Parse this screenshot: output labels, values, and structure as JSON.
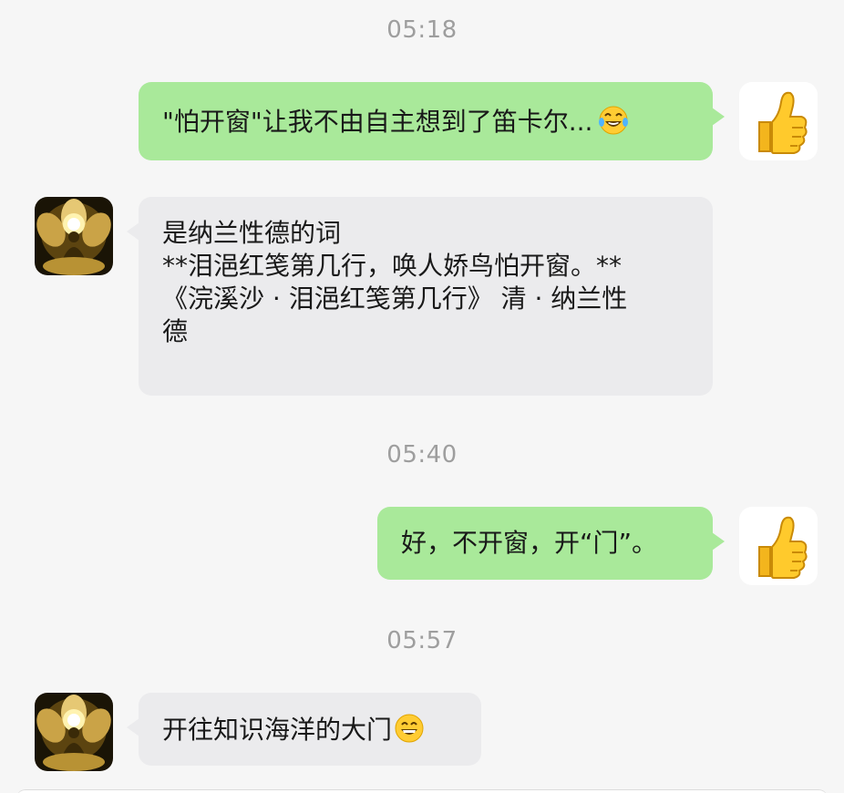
{
  "messages": [
    {
      "type": "timestamp",
      "text": "05:18"
    },
    {
      "type": "outgoing",
      "text": "\"怕开窗\"让我不由自主想到了笛卡尔...",
      "emoji": "tears-of-joy-emoji",
      "avatar": "thumbs-up-avatar"
    },
    {
      "type": "incoming",
      "lines": [
        "是纳兰性德的词",
        "**泪浥红笺第几行，唤人娇鸟怕开窗。**",
        "《浣溪沙 · 泪浥红笺第几行》 清 · 纳兰性",
        "德"
      ],
      "avatar": "golden-buddha-avatar"
    },
    {
      "type": "timestamp",
      "text": "05:40"
    },
    {
      "type": "outgoing",
      "text": "好，不开窗，开“门”。",
      "avatar": "thumbs-up-avatar"
    },
    {
      "type": "timestamp",
      "text": "05:57"
    },
    {
      "type": "incoming",
      "text": "开往知识海洋的大门",
      "emoji": "grinning-face-emoji",
      "avatar": "golden-buddha-avatar"
    }
  ],
  "colors": {
    "outgoing_bubble": "#a9e99a",
    "incoming_bubble": "#ebebed",
    "background": "#f6f6f6",
    "timestamp": "#9e9e9e"
  }
}
